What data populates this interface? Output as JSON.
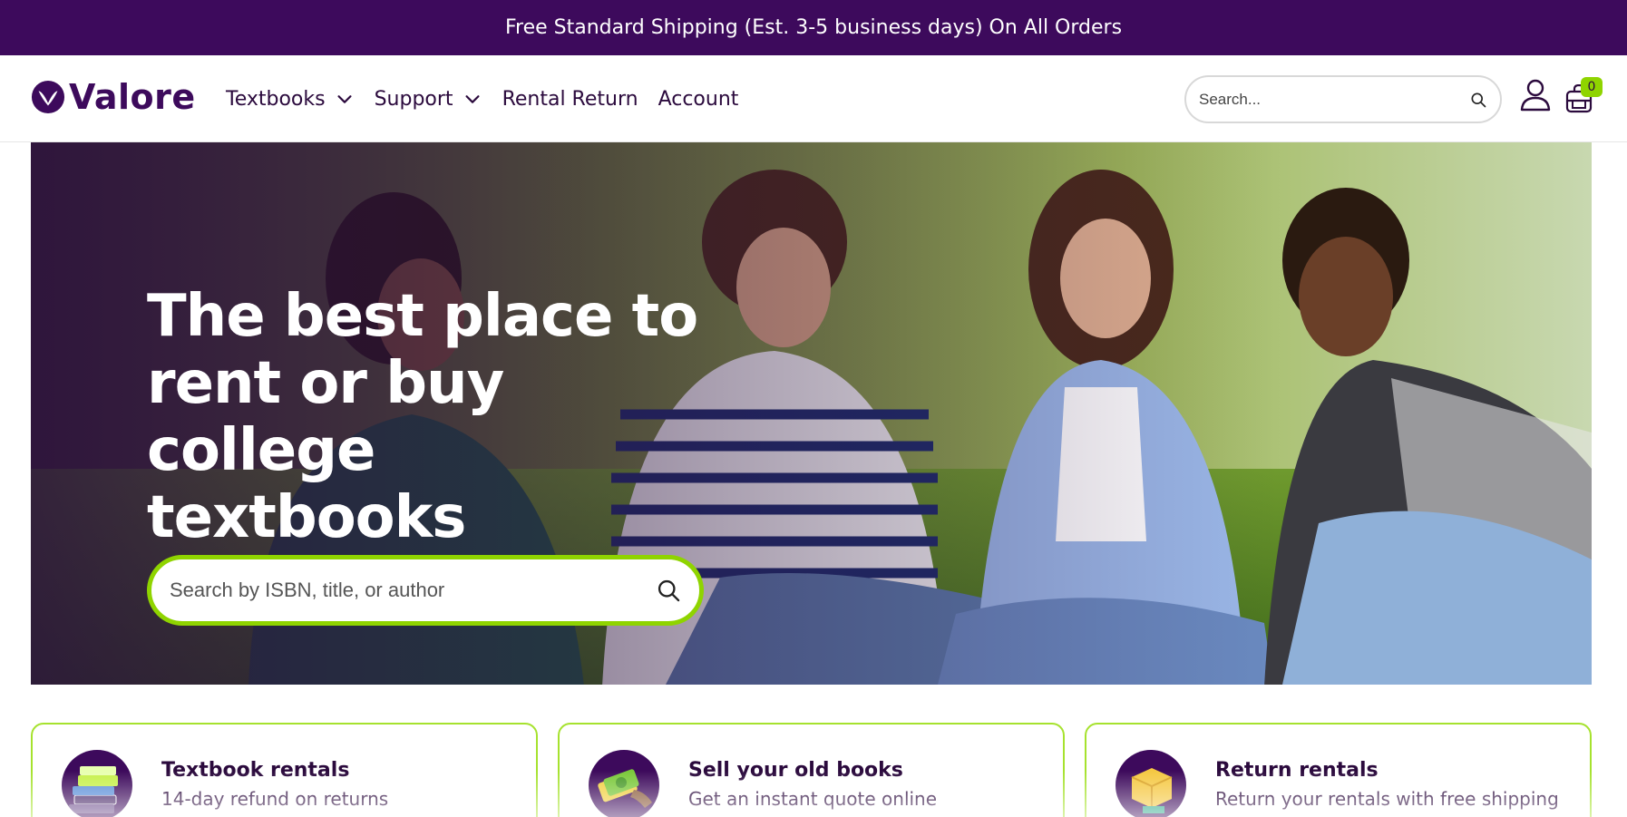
{
  "promo": {
    "text": "Free Standard Shipping (Est. 3-5 business days) On All Orders"
  },
  "header": {
    "logo_text": "Valore",
    "nav": [
      {
        "label": "Textbooks",
        "dropdown": true
      },
      {
        "label": "Support",
        "dropdown": true
      },
      {
        "label": "Rental Return",
        "dropdown": false
      },
      {
        "label": "Account",
        "dropdown": false
      }
    ],
    "search_placeholder": "Search...",
    "cart_count": "0",
    "icons": [
      "search-icon",
      "user-icon",
      "cart-icon"
    ]
  },
  "hero": {
    "title": "The best place to rent or buy college textbooks",
    "search_placeholder": "Search by ISBN, title, or author"
  },
  "cards": [
    {
      "title": "Textbook rentals",
      "subtitle": "14-day refund on returns",
      "icon": "books-icon"
    },
    {
      "title": "Sell your old books",
      "subtitle": "Get an instant quote online",
      "icon": "cash-icon"
    },
    {
      "title": "Return rentals",
      "subtitle": "Return your rentals with free shipping",
      "icon": "box-icon"
    }
  ],
  "colors": {
    "brand_purple": "#3d0a5c",
    "accent_green": "#8fd400",
    "text_dark": "#2b0a3d"
  }
}
